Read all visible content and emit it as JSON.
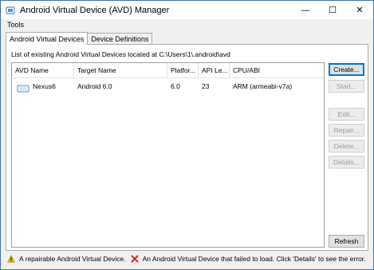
{
  "window": {
    "title": "Android Virtual Device (AVD) Manager",
    "icon": "app-icon",
    "controls": {
      "minimize": "—",
      "maximize": "☐",
      "close": "✕"
    }
  },
  "menu": {
    "tools": "Tools"
  },
  "tabs": [
    {
      "label": "Android Virtual Devices",
      "active": true
    },
    {
      "label": "Device Definitions",
      "active": false
    }
  ],
  "panel": {
    "caption": "List of existing Android Virtual Devices located at C:\\Users\\1\\.android\\avd"
  },
  "table": {
    "columns": [
      "AVD Name",
      "Target Name",
      "Platfor...",
      "API Le...",
      "CPU/ABI"
    ],
    "rows": [
      {
        "avd_name": "Nexus6",
        "target": "Android 6.0",
        "platform": "6.0",
        "api": "23",
        "cpu": "ARM (armeabi-v7a)",
        "icon": "device-icon"
      }
    ]
  },
  "buttons": {
    "create": "Create...",
    "start": "Start...",
    "edit": "Edit...",
    "repair": "Repair...",
    "delete": "Delete...",
    "details": "Details...",
    "refresh": "Refresh"
  },
  "status": {
    "warning_text": "A repairable Android Virtual Device.",
    "error_text": "An Android Virtual Device that failed to load. Click 'Details' to see the error.",
    "warning_icon": "warning-icon",
    "error_icon": "error-icon",
    "warning_color": "#e8b800",
    "error_color": "#d9261c"
  }
}
